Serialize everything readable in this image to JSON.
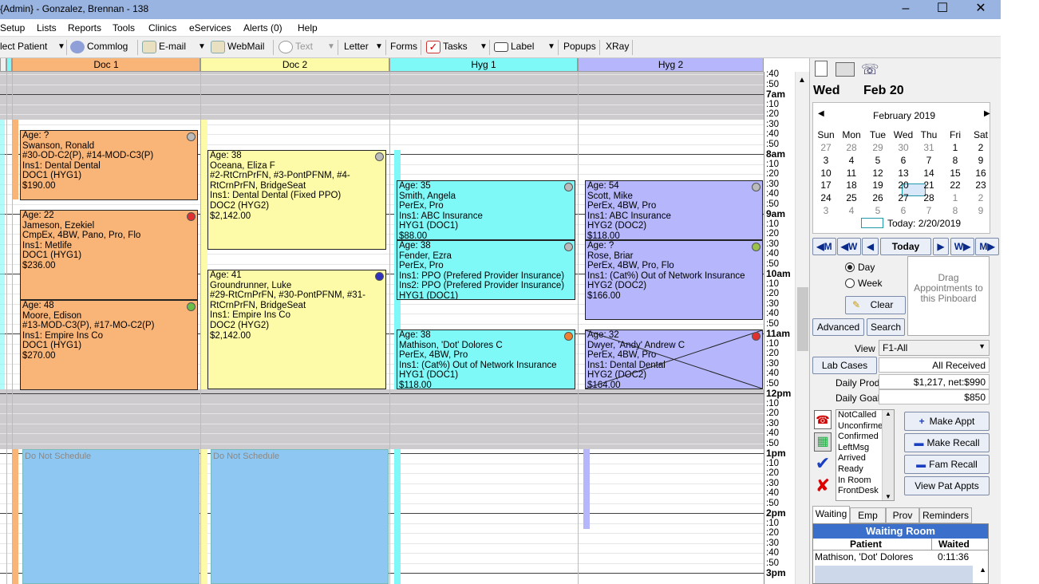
{
  "title": "{Admin} - Gonzalez, Brennan - 138",
  "window_buttons": [
    "–",
    "☐",
    "✕"
  ],
  "menu": [
    "Setup",
    "Lists",
    "Reports",
    "Tools",
    "Clinics",
    "eServices",
    "Alerts (0)",
    "Help"
  ],
  "toolbar": {
    "select_patient": "lect Patient",
    "commlog": "Commlog",
    "email": "E-mail",
    "webmail": "WebMail",
    "text": "Text",
    "letter": "Letter",
    "forms": "Forms",
    "tasks": "Tasks",
    "label": "Label",
    "popups": "Popups",
    "xray": "XRay"
  },
  "providers": [
    "Doc 1",
    "Doc 2",
    "Hyg 1",
    "Hyg 2"
  ],
  "colors": {
    "doc1": "#f9b477",
    "doc2": "#fdfba8",
    "hyg1": "#7ff8f8",
    "hyg2": "#b5b6fb",
    "blocked": "#cdcbcd",
    "dns": "#8ec8f2"
  },
  "appointments": [
    {
      "lines": [
        "Age: ?",
        "Swanson, Ronald",
        "#30-OD-C2(P), #14-MOD-C3(P)",
        "Ins1: Dental Dental",
        "DOC1 (HYG1)",
        "$190.00"
      ],
      "dot": "#bbbbbb"
    },
    {
      "lines": [
        "Age: 22",
        "Jameson, Ezekiel",
        "CmpEx, 4BW, Pano, Pro, Flo",
        "Ins1: Metlife",
        "DOC1 (HYG1)",
        "$236.00"
      ],
      "dot": "#e03030"
    },
    {
      "lines": [
        "Age: 48",
        "Moore, Edison",
        "#13-MOD-C3(P), #17-MO-C2(P)",
        "Ins1: Empire Ins Co",
        "DOC1 (HYG1)",
        "$270.00"
      ],
      "dot": "#6abf4b"
    },
    {
      "lines": [
        "Age: 38",
        "Oceana, Eliza F",
        "#2-RtCrnPrFN, #3-PontPFNM, #4-",
        "RtCrnPrFN, BridgeSeat",
        "Ins1: Dental Dental (Fixed PPO)",
        "DOC2 (HYG2)",
        "$2,142.00"
      ],
      "dot": "#bbbbbb"
    },
    {
      "lines": [
        "Age: 41",
        "Groundrunner, Luke",
        "#29-RtCrnPrFN, #30-PontPFNM, #31-",
        "RtCrnPrFN, BridgeSeat",
        "Ins1: Empire Ins Co",
        "DOC2 (HYG2)",
        "$2,142.00"
      ],
      "dot": "#3030c0"
    },
    {
      "lines": [
        "Age: 35",
        "Smith, Angela",
        "PerEx, Pro",
        "Ins1: ABC Insurance",
        "HYG1 (DOC1)",
        "$88.00"
      ],
      "dot": "#bbbbbb"
    },
    {
      "lines": [
        "Age: 38",
        "Fender, Ezra",
        "PerEx, Pro",
        "Ins1: PPO (Prefered Provider Insurance)",
        "Ins2: PPO (Prefered Provider Insurance)",
        "HYG1 (DOC1)"
      ],
      "dot": "#bbbbbb"
    },
    {
      "lines": [
        "Age: 38",
        "Mathison, 'Dot' Dolores C",
        "PerEx, 4BW, Pro",
        "Ins1: (Cat%) Out of Network Insurance",
        "HYG1 (DOC1)",
        "$118.00"
      ],
      "dot": "#f08030"
    },
    {
      "lines": [
        "Age: 54",
        "Scott, Mike",
        "PerEx, 4BW, Pro",
        "Ins1: ABC Insurance",
        "HYG2 (DOC2)",
        "$118.00"
      ],
      "dot": "#bbbbbb"
    },
    {
      "lines": [
        "Age: ?",
        "Rose, Briar",
        "PerEx, 4BW, Pro, Flo",
        "Ins1: (Cat%) Out of Network Insurance",
        "HYG2 (DOC2)",
        "$166.00"
      ],
      "dot": "#9bc24a"
    },
    {
      "lines": [
        "Age: 32",
        "Dwyer, 'Andy' Andrew C",
        "PerEx, 4BW, Pro",
        "Ins1: Dental Dental",
        "HYG2 (DOC2)",
        "$164.00"
      ],
      "dot": "#e03030"
    }
  ],
  "do_not_schedule": "Do Not Schedule",
  "times": [
    {
      "t": ":40"
    },
    {
      "t": ":50"
    },
    {
      "t": "7am",
      "big": true
    },
    {
      "t": ":10"
    },
    {
      "t": ":20"
    },
    {
      "t": ":30"
    },
    {
      "t": ":40"
    },
    {
      "t": ":50"
    },
    {
      "t": "8am",
      "big": true
    },
    {
      "t": ":10"
    },
    {
      "t": ":20"
    },
    {
      "t": ":30"
    },
    {
      "t": ":40"
    },
    {
      "t": ":50"
    },
    {
      "t": "9am",
      "big": true
    },
    {
      "t": ":10"
    },
    {
      "t": ":20"
    },
    {
      "t": ":30"
    },
    {
      "t": ":40"
    },
    {
      "t": ":50"
    },
    {
      "t": "10am",
      "big": true
    },
    {
      "t": ":10"
    },
    {
      "t": ":20"
    },
    {
      "t": ":30"
    },
    {
      "t": ":40"
    },
    {
      "t": ":50"
    },
    {
      "t": "11am",
      "big": true
    },
    {
      "t": ":10"
    },
    {
      "t": ":20"
    },
    {
      "t": ":30"
    },
    {
      "t": ":40"
    },
    {
      "t": ":50"
    },
    {
      "t": "12pm",
      "big": true
    },
    {
      "t": ":10"
    },
    {
      "t": ":20"
    },
    {
      "t": ":30"
    },
    {
      "t": ":40"
    },
    {
      "t": ":50"
    },
    {
      "t": "1pm",
      "big": true
    },
    {
      "t": ":10"
    },
    {
      "t": ":20"
    },
    {
      "t": ":30"
    },
    {
      "t": ":40"
    },
    {
      "t": ":50"
    },
    {
      "t": "2pm",
      "big": true
    },
    {
      "t": ":10"
    },
    {
      "t": ":20"
    },
    {
      "t": ":30"
    },
    {
      "t": ":40"
    },
    {
      "t": ":50"
    },
    {
      "t": "3pm",
      "big": true
    }
  ],
  "right": {
    "day": "Wed",
    "date": "Feb 20",
    "month_label": "February 2019",
    "dow": [
      "Sun",
      "Mon",
      "Tue",
      "Wed",
      "Thu",
      "Fri",
      "Sat"
    ],
    "weeks": [
      [
        "27",
        "28",
        "29",
        "30",
        "31",
        "1",
        "2"
      ],
      [
        "3",
        "4",
        "5",
        "6",
        "7",
        "8",
        "9"
      ],
      [
        "10",
        "11",
        "12",
        "13",
        "14",
        "15",
        "16"
      ],
      [
        "17",
        "18",
        "19",
        "20",
        "21",
        "22",
        "23"
      ],
      [
        "24",
        "25",
        "26",
        "27",
        "28",
        "1",
        "2"
      ],
      [
        "3",
        "4",
        "5",
        "6",
        "7",
        "8",
        "9"
      ]
    ],
    "today_label": "Today: 2/20/2019",
    "nav": {
      "month_back": "M",
      "week_back": "W",
      "today": "Today",
      "week_fwd": "W",
      "month_fwd": "M"
    },
    "day_radio": "Day",
    "week_radio": "Week",
    "pinboard": "Drag Appointments to this Pinboard",
    "clear": "Clear",
    "advanced": "Advanced",
    "search": "Search",
    "view_label": "View",
    "view_value": "F1-All",
    "lab_cases": "Lab Cases",
    "lab_status": "All Received",
    "daily_prod_label": "Daily Prod",
    "daily_prod": "$1,217, net:$990",
    "daily_goal_label": "Daily Goal",
    "daily_goal": "$850",
    "statuses": [
      "NotCalled",
      "Unconfirmed",
      "Confirmed",
      "LeftMsg",
      "Arrived",
      "Ready",
      "In Room",
      "FrontDesk"
    ],
    "make_appt": "Make Appt",
    "make_recall": "Make Recall",
    "fam_recall": "Fam Recall",
    "view_pat_appts": "View Pat Appts",
    "tabs": [
      "Waiting",
      "Emp",
      "Prov",
      "Reminders"
    ],
    "waiting_room_title": "Waiting Room",
    "wr_headers": [
      "Patient",
      "Waited"
    ],
    "wr_rows": [
      [
        "Mathison, 'Dot' Dolores",
        "0:11:36"
      ]
    ]
  }
}
